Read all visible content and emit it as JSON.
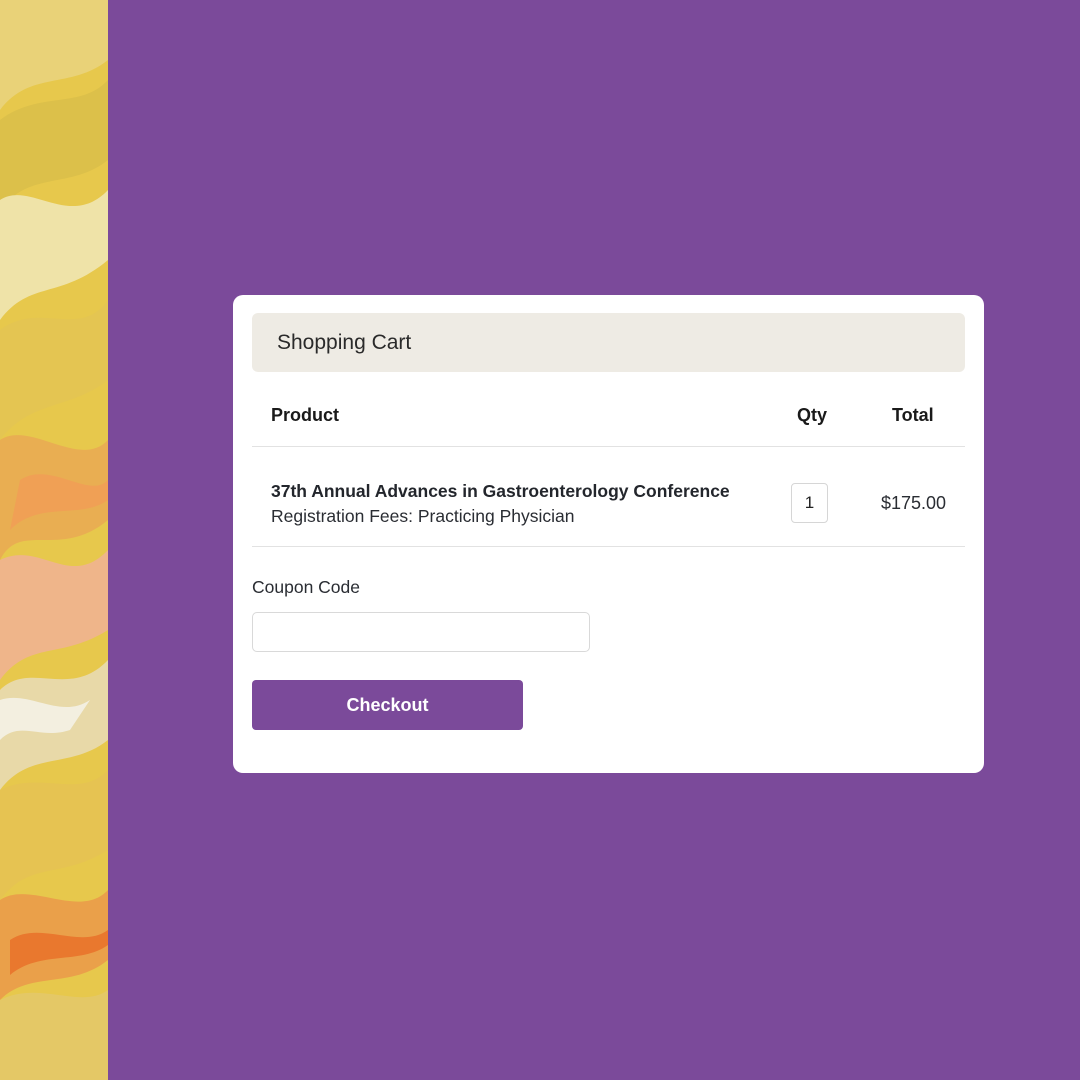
{
  "cart": {
    "title": "Shopping Cart",
    "columns": {
      "product": "Product",
      "qty": "Qty",
      "total": "Total"
    },
    "items": [
      {
        "name": "37th Annual Advances in Gastroenterology Conference",
        "subtitle": "Registration Fees: Practicing Physician",
        "qty": "1",
        "total": "$175.00"
      }
    ],
    "coupon": {
      "label": "Coupon Code",
      "value": "",
      "placeholder": ""
    },
    "checkout_label": "Checkout"
  },
  "colors": {
    "background": "#7b4a9a",
    "accent": "#7b4a9a",
    "header_bg": "#eeebe4",
    "card": "#ffffff"
  }
}
